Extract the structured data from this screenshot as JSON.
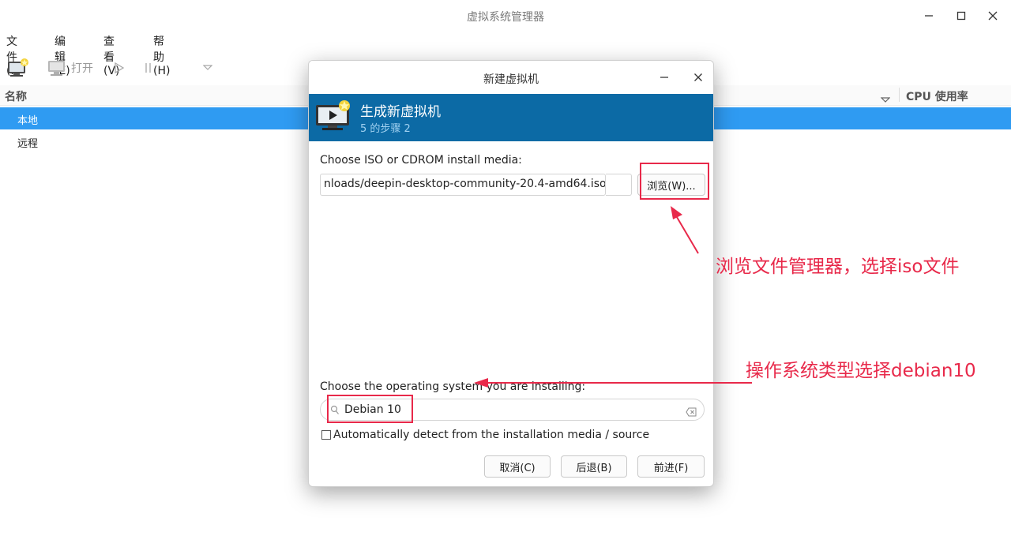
{
  "window": {
    "title": "虚拟系统管理器",
    "controls": [
      "minimize-icon",
      "maximize-icon",
      "close-icon"
    ]
  },
  "menubar": {
    "items": [
      "文件(F)",
      "编辑(E)",
      "查看(V)",
      "帮助(H)"
    ]
  },
  "toolbar": {
    "open_label": "打开",
    "icons": [
      "new-vm-icon",
      "monitor-icon",
      "play-icon",
      "pause-icon",
      "dropdown-icon"
    ]
  },
  "list": {
    "columns": [
      "名称",
      "CPU 使用率"
    ],
    "rows": [
      {
        "label": "本地",
        "selected": true
      },
      {
        "label": "远程",
        "selected": false
      }
    ]
  },
  "dialog": {
    "title": "新建虚拟机",
    "banner": {
      "title": "生成新虚拟机",
      "subtitle": "5 的步骤 2"
    },
    "iso_label": "Choose ISO or CDROM install media:",
    "iso_value": "nloads/deepin-desktop-community-20.4-amd64.iso",
    "browse_label": "浏览(W)...",
    "os_label": "Choose the operating system you are installing:",
    "os_value": "Debian 10",
    "auto_detect_label": "Automatically detect from the installation media / source",
    "auto_detect_checked": false,
    "buttons": {
      "cancel": "取消(C)",
      "back": "后退(B)",
      "forward": "前进(F)"
    }
  },
  "annotations": {
    "browse_note": "浏览文件管理器，选择iso文件",
    "os_note": "操作系统类型选择debian10"
  },
  "colors": {
    "selection": "#2f9bf2",
    "banner": "#0c6aa5",
    "annotation": "#e8294a"
  }
}
